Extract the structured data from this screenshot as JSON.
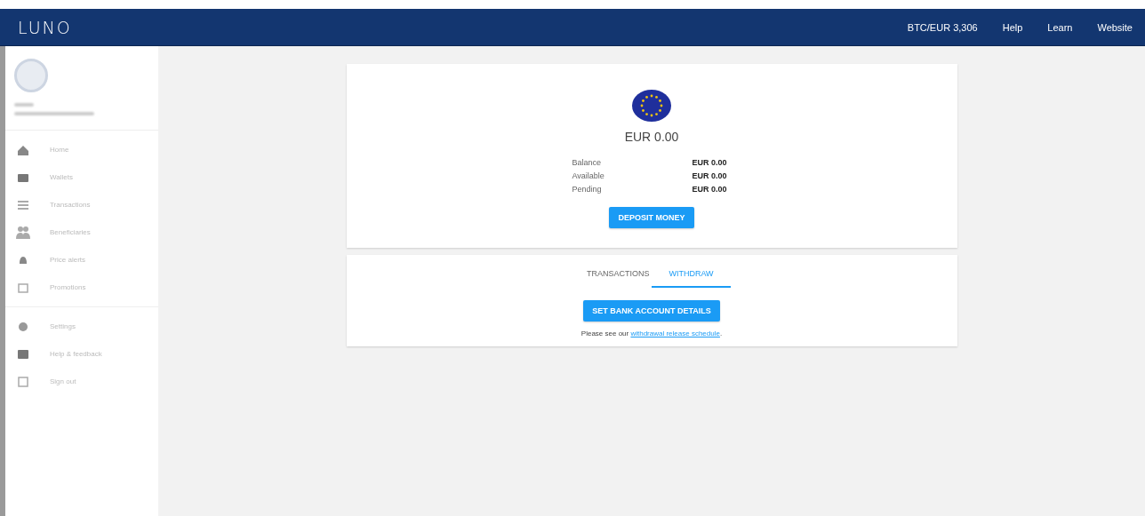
{
  "header": {
    "logo": "LUNO",
    "links": [
      "BTC/EUR 3,306",
      "Help",
      "Learn",
      "Website"
    ]
  },
  "sidebar": {
    "sections": [
      {
        "items": [
          {
            "label": "Home"
          },
          {
            "label": "Wallets"
          },
          {
            "label": "Transactions"
          },
          {
            "label": "Beneficiaries"
          },
          {
            "label": "Price alerts"
          },
          {
            "label": "Promotions"
          }
        ]
      },
      {
        "items": [
          {
            "label": "Settings"
          },
          {
            "label": "Help & feedback"
          },
          {
            "label": "Sign out"
          }
        ]
      }
    ]
  },
  "wallet": {
    "total": "EUR 0.00",
    "rows": [
      {
        "label": "Balance",
        "value": "EUR 0.00"
      },
      {
        "label": "Available",
        "value": "EUR 0.00"
      },
      {
        "label": "Pending",
        "value": "EUR 0.00"
      }
    ],
    "button": "DEPOSIT MONEY"
  },
  "tabs": [
    {
      "label": "TRANSACTIONS",
      "selected": false
    },
    {
      "label": "WITHDRAW",
      "selected": true
    }
  ],
  "withdraw": {
    "button": "SET BANK ACCOUNT DETAILS",
    "note_prefix": "Please see our ",
    "note_link": "withdrawal release schedule",
    "note_suffix": "."
  }
}
